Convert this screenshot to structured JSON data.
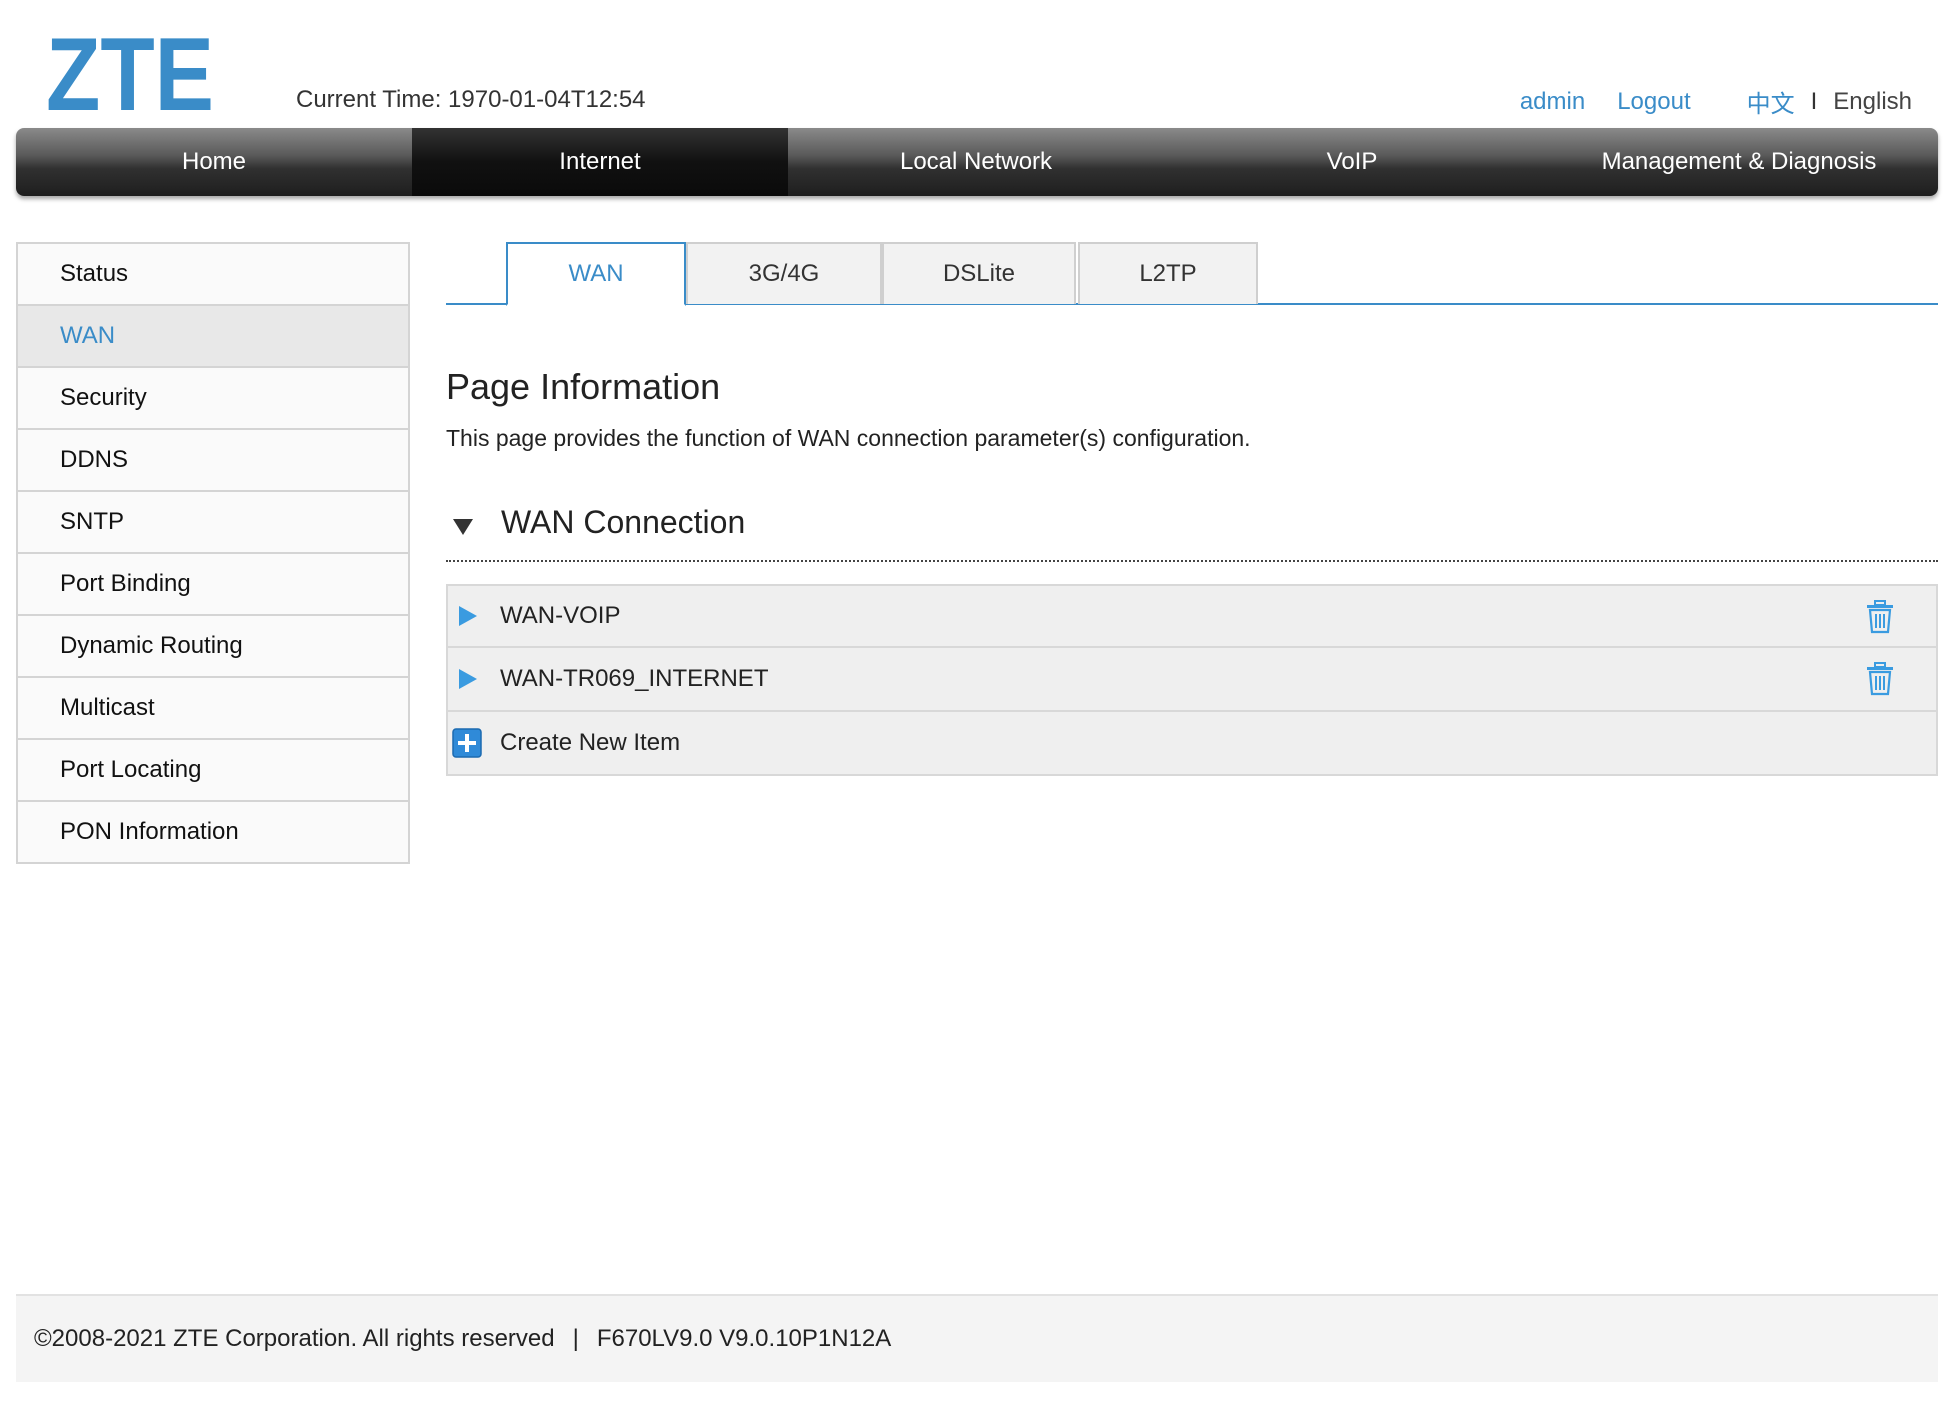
{
  "header": {
    "logo_text": "ZTE",
    "current_time_label": "Current Time:",
    "current_time_value": "1970-01-04T12:54",
    "user": "admin",
    "logout": "Logout",
    "lang_cn": "中文",
    "lang_sep": "I",
    "lang_en": "English",
    "brand_color": "#3a8cc8"
  },
  "nav": {
    "items": [
      {
        "label": "Home"
      },
      {
        "label": "Internet"
      },
      {
        "label": "Local Network"
      },
      {
        "label": "VoIP"
      },
      {
        "label": "Management & Diagnosis"
      }
    ],
    "active": "Internet"
  },
  "sidebar": {
    "items": [
      {
        "label": "Status"
      },
      {
        "label": "WAN"
      },
      {
        "label": "Security"
      },
      {
        "label": "DDNS"
      },
      {
        "label": "SNTP"
      },
      {
        "label": "Port Binding"
      },
      {
        "label": "Dynamic Routing"
      },
      {
        "label": "Multicast"
      },
      {
        "label": "Port Locating"
      },
      {
        "label": "PON Information"
      }
    ],
    "active": "WAN"
  },
  "tabs": {
    "items": [
      {
        "label": "WAN"
      },
      {
        "label": "3G/4G"
      },
      {
        "label": "DSLite"
      },
      {
        "label": "L2TP"
      }
    ],
    "active": "WAN"
  },
  "page_info": {
    "title": "Page Information",
    "description": "This page provides the function of WAN connection parameter(s) configuration."
  },
  "wan_section": {
    "title": "WAN Connection",
    "connections": [
      {
        "name": "WAN-VOIP"
      },
      {
        "name": "WAN-TR069_INTERNET"
      }
    ],
    "create_label": "Create New Item"
  },
  "footer": {
    "copyright": "©2008-2021 ZTE Corporation. All rights reserved",
    "separator": "|",
    "version": "F670LV9.0 V9.0.10P1N12A"
  }
}
